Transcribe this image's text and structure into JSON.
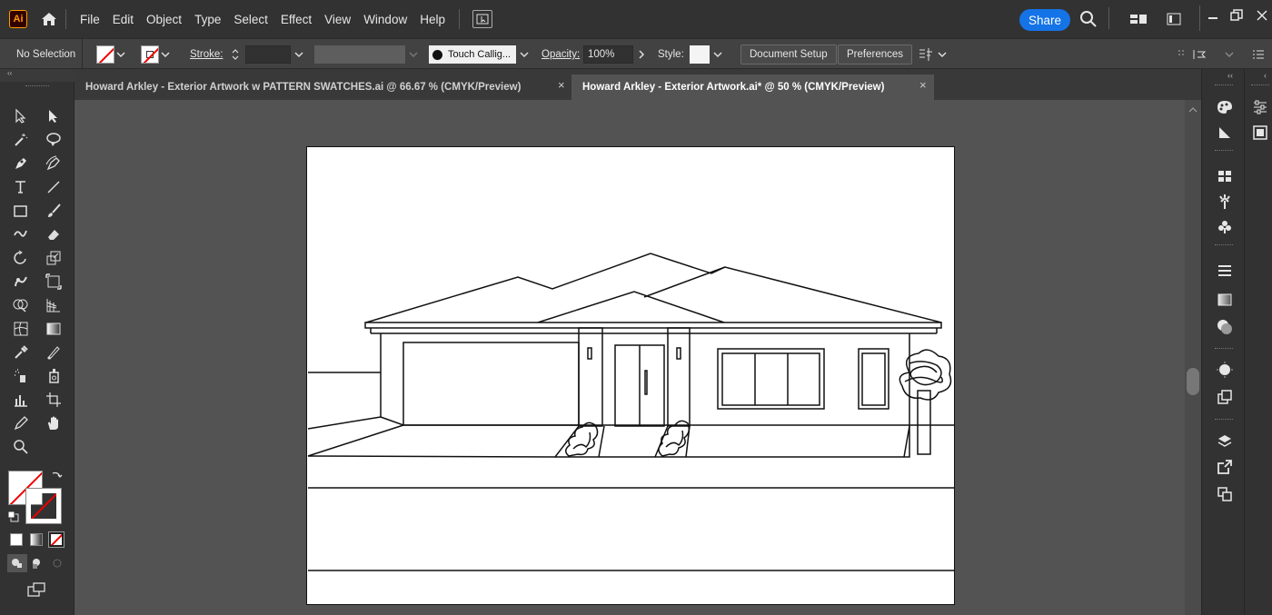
{
  "app": {
    "logo": "Ai"
  },
  "menubar": {
    "items": [
      "File",
      "Edit",
      "Object",
      "Type",
      "Select",
      "Effect",
      "View",
      "Window",
      "Help"
    ],
    "share_label": "Share"
  },
  "controlbar": {
    "selection": "No Selection",
    "stroke_label": "Stroke:",
    "brush_name": "Touch Callig...",
    "opacity_label": "Opacity:",
    "opacity_value": "100%",
    "style_label": "Style:",
    "document_setup": "Document Setup",
    "preferences": "Preferences"
  },
  "tabs": [
    {
      "label": "Howard Arkley - Exterior Artwork w PATTERN SWATCHES.ai @ 66.67 % (CMYK/Preview)",
      "active": false
    },
    {
      "label": "Howard Arkley - Exterior Artwork.ai* @ 50 % (CMYK/Preview)",
      "active": true
    }
  ],
  "tab_close_glyph": "×",
  "colors": {
    "accent": "#1473e6",
    "ai_logo": "#ff9a00",
    "none_swatch_red": "#e00000"
  },
  "icons": {
    "left_tools": [
      "selection-tool-icon",
      "direct-selection-tool-icon",
      "magic-wand-icon",
      "lasso-icon",
      "pen-tool-icon",
      "curvature-tool-icon",
      "type-tool-icon",
      "line-tool-icon",
      "rectangle-tool-icon",
      "paintbrush-icon",
      "shaper-tool-icon",
      "eraser-icon",
      "rotate-tool-icon",
      "scale-tool-icon",
      "warp-tool-icon",
      "free-transform-icon",
      "shape-builder-icon",
      "perspective-grid-icon",
      "mesh-tool-icon",
      "gradient-tool-icon",
      "eyedropper-icon",
      "blend-tool-icon",
      "symbol-sprayer-icon",
      "column-graph-icon",
      "artboard-tool-icon",
      "slice-tool-icon",
      "hand-tool-icon",
      "zoom-tool-icon"
    ]
  }
}
